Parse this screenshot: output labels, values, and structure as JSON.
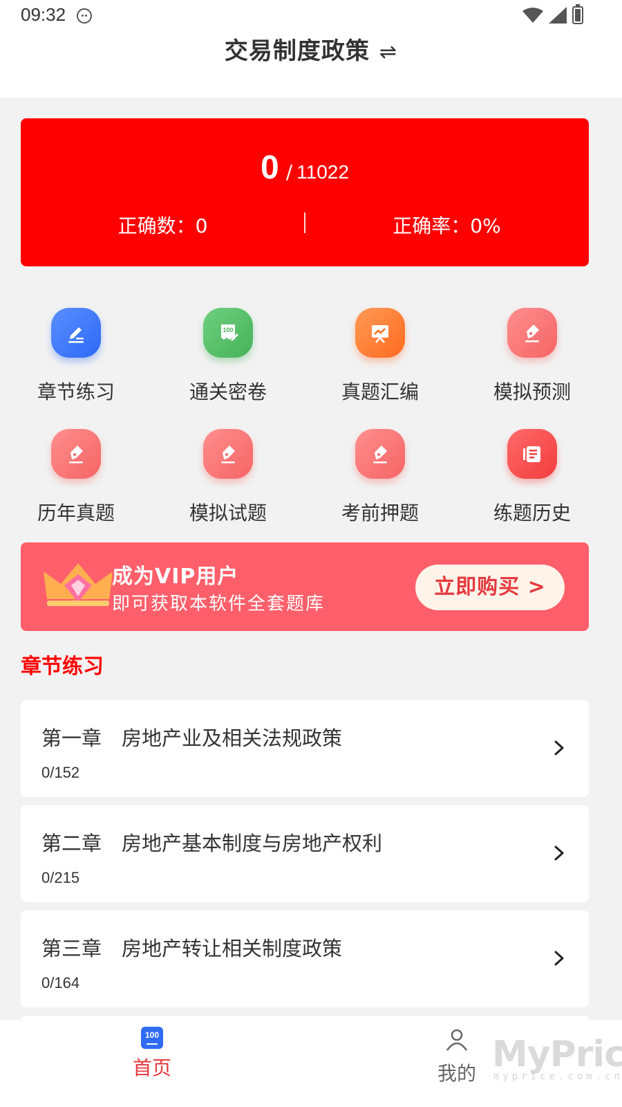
{
  "status": {
    "time": "09:32"
  },
  "header": {
    "title": "交易制度政策",
    "switch_icon": "swap-icon"
  },
  "score": {
    "done": "0",
    "separator": "/",
    "total": "11022",
    "correct_count": "正确数：0",
    "correct_rate": "正确率：0%"
  },
  "grid": [
    {
      "label": "章节练习",
      "icon": "edit-icon",
      "color": "#2d6af5"
    },
    {
      "label": "通关密卷",
      "icon": "score-100-icon",
      "color": "#46b25a"
    },
    {
      "label": "真题汇编",
      "icon": "presentation-chart-icon",
      "color": "#ff6a20"
    },
    {
      "label": "模拟预测",
      "icon": "pen-nib-icon",
      "color": "#f56565"
    },
    {
      "label": "历年真题",
      "icon": "pen-nib-icon",
      "color": "#f56565"
    },
    {
      "label": "模拟试题",
      "icon": "pen-nib-icon",
      "color": "#f56565"
    },
    {
      "label": "考前押题",
      "icon": "pen-nib-icon",
      "color": "#f56565"
    },
    {
      "label": "练题历史",
      "icon": "history-notebook-icon",
      "color": "#f23d3d"
    }
  ],
  "vip": {
    "title": "成为VIP用户",
    "subtitle": "即可获取本软件全套题库",
    "button": "立即购买 >"
  },
  "section": {
    "title": "章节练习"
  },
  "chapters": [
    {
      "name": "第一章　房地产业及相关法规政策",
      "progress": "0/152"
    },
    {
      "name": "第二章　房地产基本制度与房地产权利",
      "progress": "0/215"
    },
    {
      "name": "第三章　房地产转让相关制度政策",
      "progress": "0/164"
    }
  ],
  "tabs": {
    "home": {
      "label": "首页",
      "icon_text": "100"
    },
    "mine": {
      "label": "我的"
    }
  },
  "watermark": {
    "text": "MyPrice",
    "sub": "myprice.com.cn"
  },
  "colors": {
    "primary_red": "#ff0000",
    "vip_bg": "#ff5f6a",
    "tab_active": "#e5393d",
    "background": "#f2f2f2"
  }
}
